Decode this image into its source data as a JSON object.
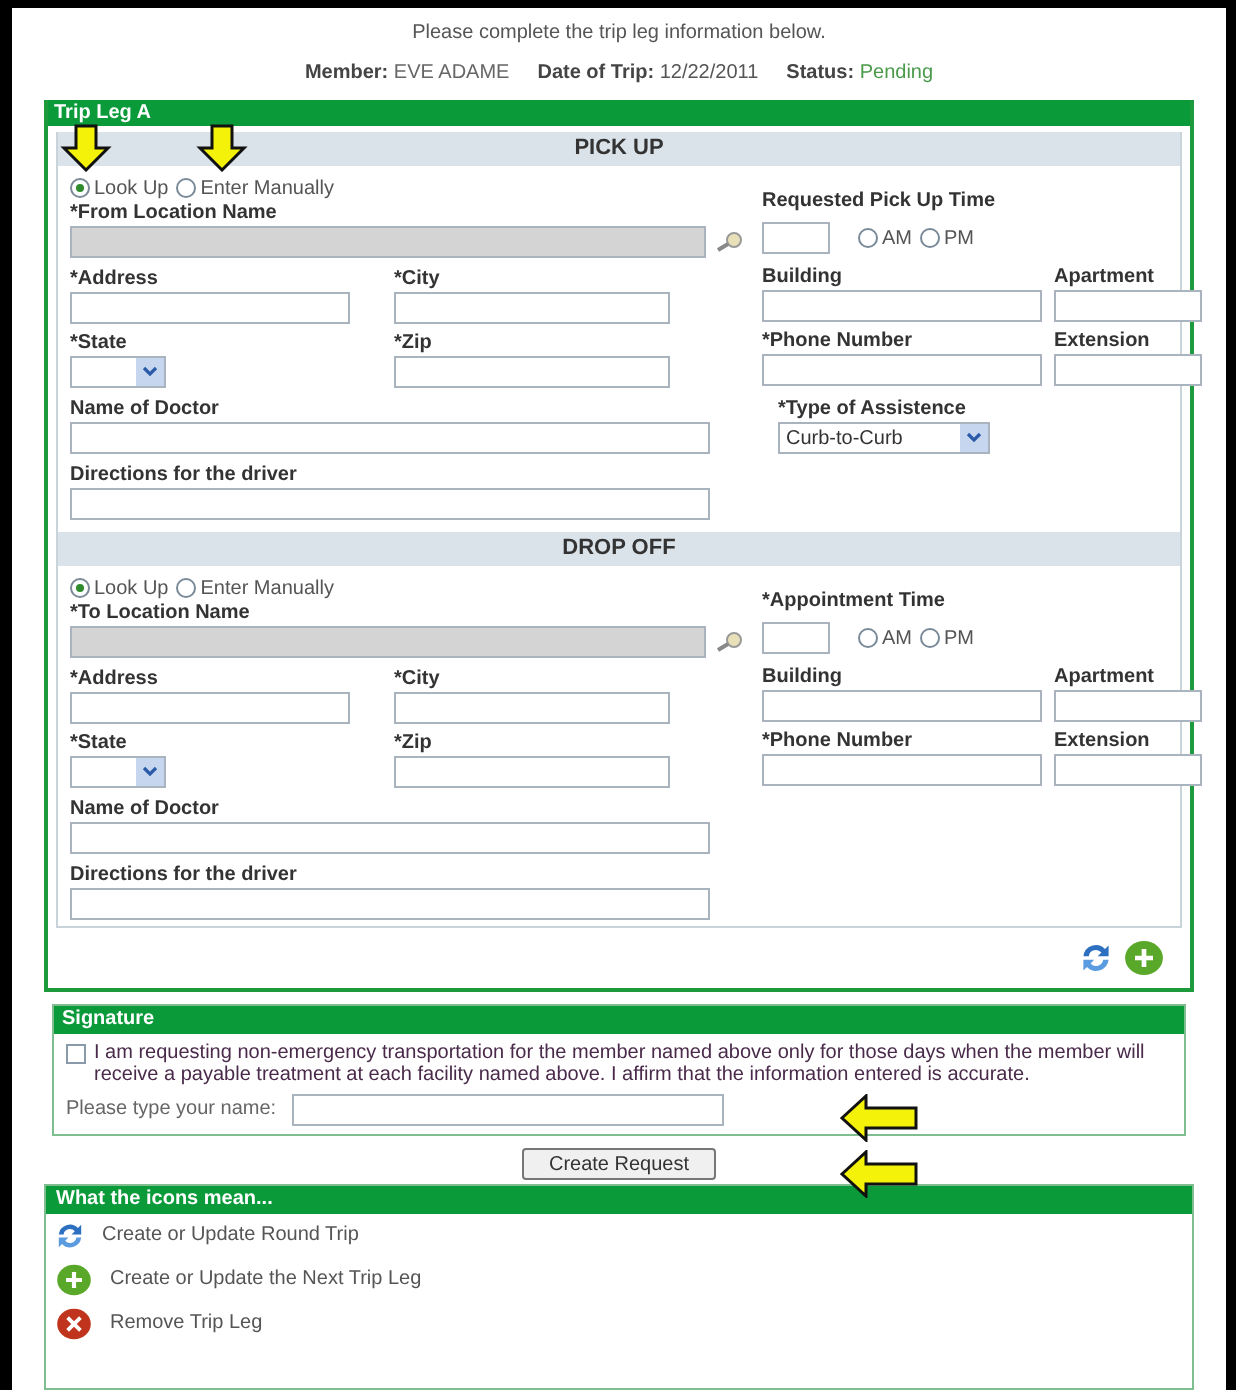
{
  "header": {
    "instruction": "Please complete the trip leg information below.",
    "member_label": "Member:",
    "member": "EVE ADAME",
    "date_label": "Date of Trip:",
    "date": "12/22/2011",
    "status_label": "Status:",
    "status": "Pending"
  },
  "trip_leg": {
    "title": "Trip Leg A",
    "sections": [
      {
        "title": "PICK UP",
        "modes": [
          {
            "label": "Look Up",
            "selected": true
          },
          {
            "label": "Enter Manually",
            "selected": false
          }
        ],
        "location_label": "*From Location Name",
        "time_label": "Requested Pick Up Time",
        "meridiem": [
          {
            "label": "AM",
            "selected": false
          },
          {
            "label": "PM",
            "selected": false
          }
        ],
        "address_label": "*Address",
        "city_label": "*City",
        "state_label": "*State",
        "zip_label": "*Zip",
        "doctor_label": "Name of Doctor",
        "directions_label": "Directions for the driver",
        "building_label": "Building",
        "apartment_label": "Apartment",
        "phone_label": "*Phone Number",
        "extension_label": "Extension",
        "assistance": {
          "label": "*Type of Assistence",
          "value": "Curb-to-Curb"
        }
      },
      {
        "title": "DROP OFF",
        "modes": [
          {
            "label": "Look Up",
            "selected": true
          },
          {
            "label": "Enter Manually",
            "selected": false
          }
        ],
        "location_label": "*To Location Name",
        "time_label": "*Appointment Time",
        "meridiem": [
          {
            "label": "AM",
            "selected": false
          },
          {
            "label": "PM",
            "selected": false
          }
        ],
        "address_label": "*Address",
        "city_label": "*City",
        "state_label": "*State",
        "zip_label": "*Zip",
        "doctor_label": "Name of Doctor",
        "directions_label": "Directions for the driver",
        "building_label": "Building",
        "apartment_label": "Apartment",
        "phone_label": "*Phone Number",
        "extension_label": "Extension"
      }
    ],
    "actions": [
      {
        "kind": "round-trip"
      },
      {
        "kind": "next-leg"
      }
    ]
  },
  "signature": {
    "title": "Signature",
    "checked": false,
    "statement": "I am requesting non-emergency transportation for the member named above only for those days when the member will receive a payable treatment at each facility named above. I affirm that the information entered is accurate.",
    "name_label": "Please type your name:"
  },
  "submit": "Create Request",
  "legend": {
    "title": "What the icons mean...",
    "items": [
      {
        "kind": "round-trip",
        "label": "Create or Update Round Trip"
      },
      {
        "kind": "next-leg",
        "label": "Create or Update the Next Trip Leg"
      },
      {
        "kind": "remove",
        "label": "Remove Trip Leg"
      }
    ]
  }
}
